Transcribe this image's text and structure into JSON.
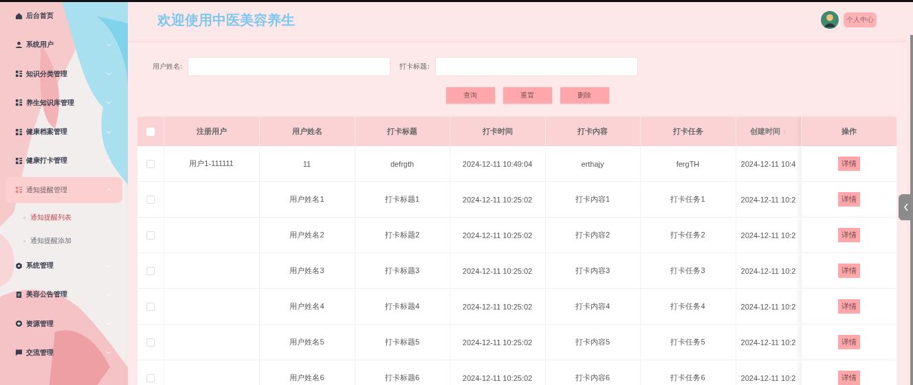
{
  "sidebar": {
    "items": [
      {
        "label": "后台首页",
        "kind": "link",
        "selected": false
      },
      {
        "label": "系统用户",
        "kind": "menu",
        "expanded": false,
        "selected": false
      },
      {
        "label": "知识分类管理",
        "kind": "menu",
        "expanded": false,
        "selected": false
      },
      {
        "label": "养生知识库管理",
        "kind": "menu",
        "expanded": false,
        "selected": false
      },
      {
        "label": "健康档案管理",
        "kind": "menu",
        "expanded": false,
        "selected": false
      },
      {
        "label": "健康打卡管理",
        "kind": "menu",
        "expanded": false,
        "selected": false
      },
      {
        "label": "通知提醒管理",
        "kind": "menu",
        "expanded": true,
        "selected": true,
        "children": [
          {
            "label": "通知提醒列表",
            "selected": true
          },
          {
            "label": "通知提醒添加",
            "selected": false
          }
        ]
      },
      {
        "label": "系统管理",
        "kind": "menu",
        "expanded": false,
        "selected": false
      },
      {
        "label": "美容公告管理",
        "kind": "menu",
        "expanded": false,
        "selected": false
      },
      {
        "label": "资源管理",
        "kind": "menu",
        "expanded": false,
        "selected": false
      },
      {
        "label": "交流管理",
        "kind": "menu",
        "expanded": false,
        "selected": false
      }
    ]
  },
  "header": {
    "title": "欢迎使用中医美容养生",
    "profile_button": "个人中心"
  },
  "search": {
    "fields": [
      {
        "label": "用户姓名:"
      },
      {
        "label": "打卡标题:"
      }
    ],
    "buttons": [
      "查询",
      "重置",
      "删除"
    ]
  },
  "table": {
    "all_checked": false,
    "columns": [
      {
        "label": "注册用户",
        "sortable": false
      },
      {
        "label": "用户姓名",
        "sortable": false
      },
      {
        "label": "打卡标题",
        "sortable": false
      },
      {
        "label": "打卡时间",
        "sortable": false
      },
      {
        "label": "打卡内容",
        "sortable": false
      },
      {
        "label": "打卡任务",
        "sortable": false
      },
      {
        "label": "创建时间",
        "sortable": true
      },
      {
        "label": "操作",
        "sortable": false
      }
    ],
    "rows": [
      {
        "checked": false,
        "cells": [
          "用户1-111111",
          "11",
          "defrgth",
          "2024-12-11 10:49:04",
          "erthajy",
          "fergTH",
          "2024-12-11 10:4"
        ],
        "action": "详情"
      },
      {
        "checked": false,
        "cells": [
          "",
          "用户姓名1",
          "打卡标题1",
          "2024-12-11 10:25:02",
          "打卡内容1",
          "打卡任务1",
          "2024-12-11 10:2"
        ],
        "action": "详情"
      },
      {
        "checked": false,
        "cells": [
          "",
          "用户姓名2",
          "打卡标题2",
          "2024-12-11 10:25:02",
          "打卡内容2",
          "打卡任务2",
          "2024-12-11 10:2"
        ],
        "action": "详情"
      },
      {
        "checked": false,
        "cells": [
          "",
          "用户姓名3",
          "打卡标题3",
          "2024-12-11 10:25:02",
          "打卡内容3",
          "打卡任务3",
          "2024-12-11 10:2"
        ],
        "action": "详情"
      },
      {
        "checked": false,
        "cells": [
          "",
          "用户姓名4",
          "打卡标题4",
          "2024-12-11 10:25:02",
          "打卡内容4",
          "打卡任务4",
          "2024-12-11 10:2"
        ],
        "action": "详情"
      },
      {
        "checked": false,
        "cells": [
          "",
          "用户姓名5",
          "打卡标题5",
          "2024-12-11 10:25:02",
          "打卡内容5",
          "打卡任务5",
          "2024-12-11 10:2"
        ],
        "action": "详情"
      },
      {
        "checked": false,
        "cells": [
          "",
          "用户姓名6",
          "打卡标题6",
          "2024-12-11 10:25:02",
          "打卡内容6",
          "打卡任务6",
          "2024-12-11 10:2"
        ],
        "action": "详情"
      }
    ]
  }
}
